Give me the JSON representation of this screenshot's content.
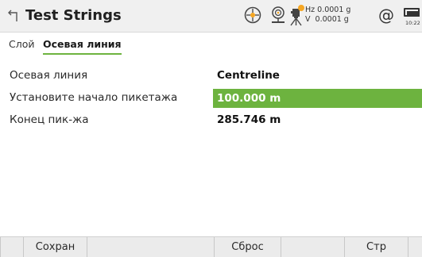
{
  "header": {
    "title": "Test Strings",
    "hz": "Hz 0.0001 g",
    "v": "V  0.0001 g",
    "at_symbol": "@",
    "time": "10:22",
    "icons": [
      "back-icon",
      "target-icon",
      "prism-icon",
      "instrument-icon",
      "battery-icon"
    ],
    "badge_color": "#f5a623"
  },
  "tabs": {
    "layer": "Слой",
    "active": "Осевая линия",
    "accent": "#6db33f"
  },
  "form": {
    "centreline_label": "Осевая линия",
    "centreline_value": "Centreline",
    "start_chainage_label": "Установите начало пикетажа",
    "start_chainage_value": "100.000 m",
    "end_chainage_label": "Конец пик-жа",
    "end_chainage_value": "285.746 m"
  },
  "softkeys": {
    "f2": "Сохран",
    "f4": "Сброс",
    "f6": "Стр"
  }
}
